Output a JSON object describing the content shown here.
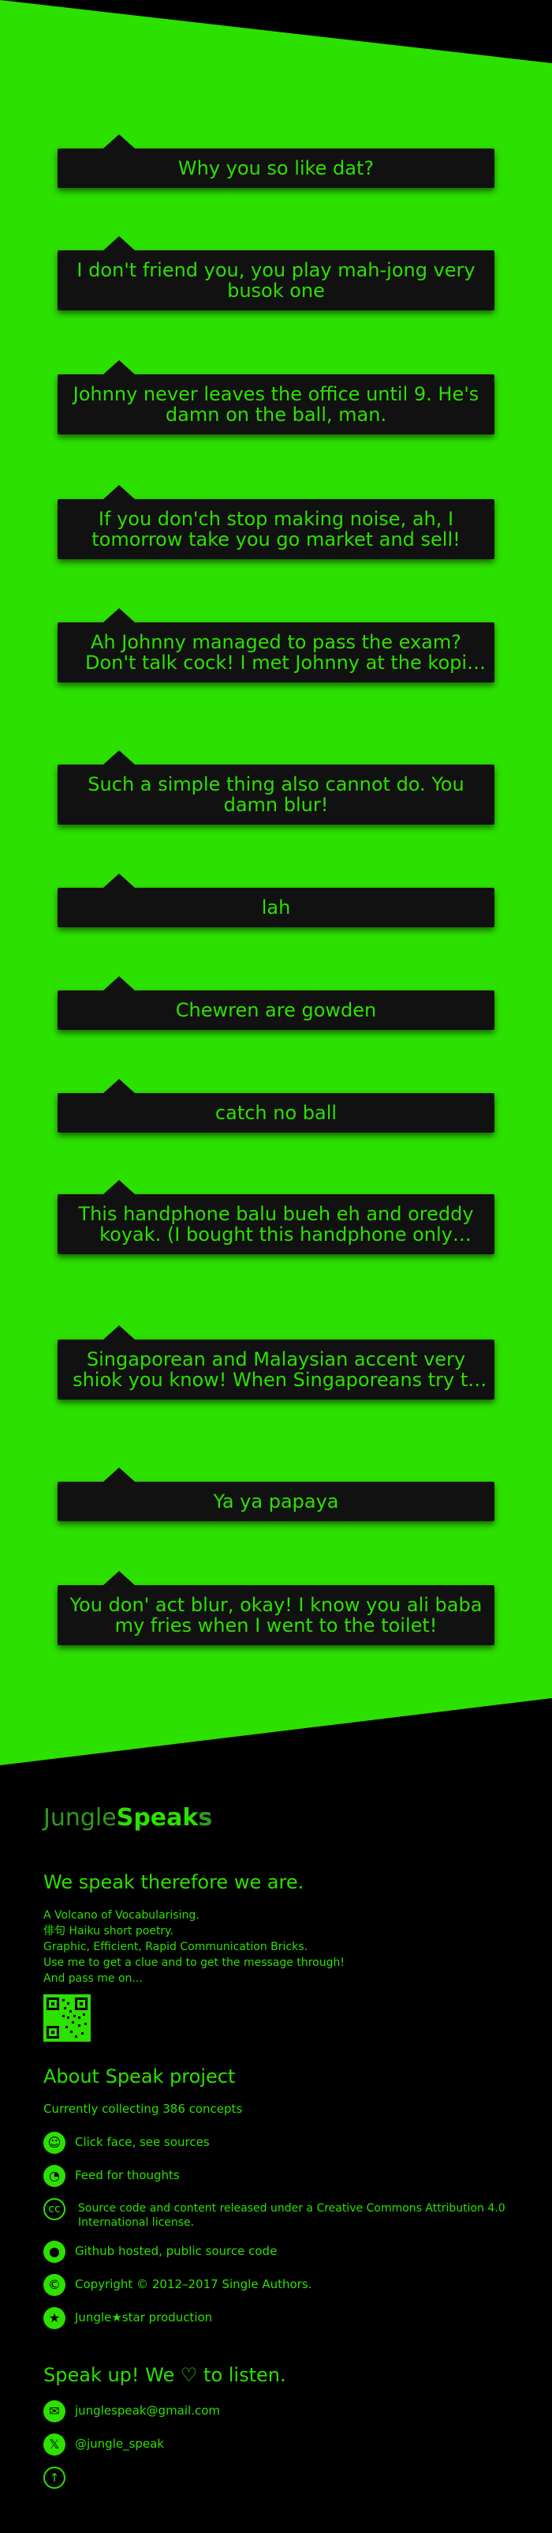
{
  "speaks": [
    "Why you so like dat?",
    "I don't friend you, you play mah-jong very busok one",
    "Johnny never leaves the office until 9. He's damn on the ball, man.",
    "If you don'ch stop making noise, ah, I tomorrow take you go market and sell!",
    "Ah Johnny managed to pass the exam? Don't talk cock! I met Johnny at the kopi tiam just now, an...",
    "Such a simple thing also cannot do. You damn blur!",
    "lah",
    "Chewren are gowden",
    "catch no ball",
    "This handphone balu bueh eh and oreddy koyak. (I bought this handphone only recently and it's a...",
    "Singaporean and Malaysian accent very shiok you know! When Singaporeans try to talk like ang mor...",
    "Ya ya papaya",
    "You don' act blur, okay! I know you ali baba my fries when I went to the toilet!"
  ],
  "footer": {
    "brand": {
      "jungle": "Jungle",
      "speak": "Speak",
      "s": "s"
    },
    "tagline": "We speak therefore we are.",
    "description": [
      "A Volcano of Vocabularising.",
      "俳句 Haiku short poetry.",
      "Graphic, Efficient, Rapid Communication Bricks.",
      "Use me to get a clue and to get the message through!",
      "And pass me on..."
    ],
    "about_title": "About Speak project",
    "collecting": "Currently collecting 386 concepts",
    "about_items": [
      {
        "icon": "smiley-icon",
        "text": "Click face, see sources"
      },
      {
        "icon": "rss-icon",
        "text": "Feed for thoughts"
      },
      {
        "icon": "cc-icon",
        "text": "Source code and content released under a Creative Commons Attribution 4.0 International license."
      },
      {
        "icon": "github-icon",
        "text": "Github hosted, public source code"
      },
      {
        "icon": "copyright-icon",
        "text": "Copyright © 2012–2017 Single Authors."
      },
      {
        "icon": "jungle-star-icon",
        "text": "Jungle★star production"
      }
    ],
    "speak_up_title": "Speak up! We ♡ to listen.",
    "contact": {
      "email": "junglespeak@gmail.com",
      "twitter": "@jungle_speak"
    }
  }
}
